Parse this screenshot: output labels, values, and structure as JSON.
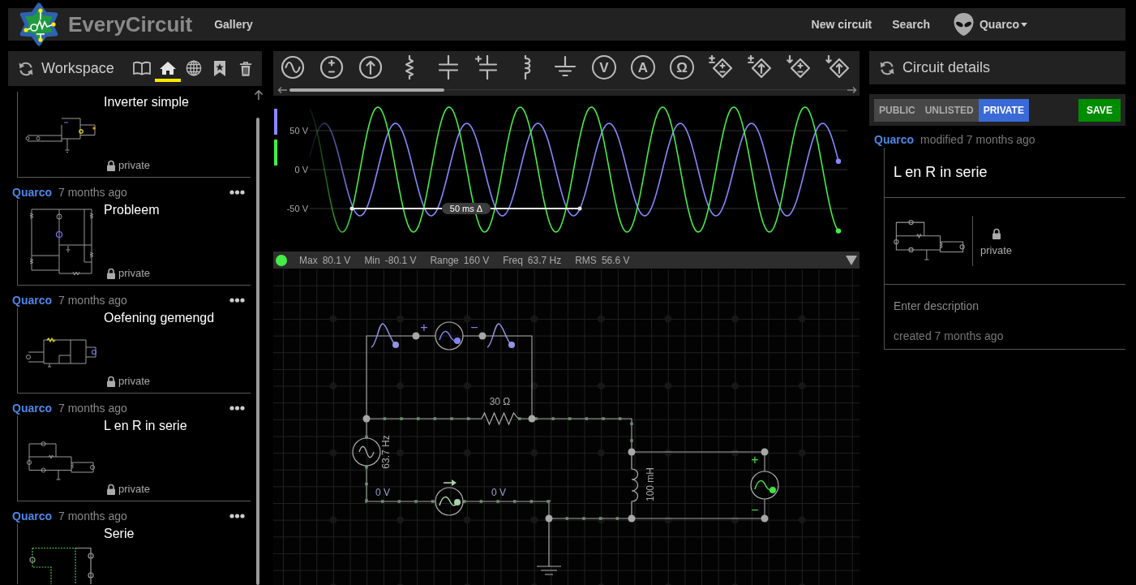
{
  "topbar": {
    "brand": "EveryCircuit",
    "nav": [
      "Gallery"
    ],
    "actions": [
      "New circuit",
      "Search"
    ],
    "user": "Quarco"
  },
  "workspace": {
    "title": "Workspace",
    "tabs": [
      {
        "kind": "book",
        "selected": false
      },
      {
        "kind": "home",
        "selected": true
      },
      {
        "kind": "globe",
        "selected": false
      },
      {
        "kind": "bookmark",
        "selected": false
      },
      {
        "kind": "trash",
        "selected": false
      }
    ],
    "circuits": [
      {
        "title": "Inverter simple",
        "visibility": "private"
      },
      {
        "author": "Quarco",
        "time": "7 months ago",
        "title": "Probleem",
        "visibility": "private"
      },
      {
        "author": "Quarco",
        "time": "7 months ago",
        "title": "Oefening gemengd",
        "visibility": "private"
      },
      {
        "author": "Quarco",
        "time": "7 months ago",
        "title": "L en R in serie",
        "visibility": "private"
      },
      {
        "author": "Quarco",
        "time": "7 months ago",
        "title": "Serie"
      }
    ]
  },
  "toolbar": {
    "items": [
      {
        "kind": "ac_voltage_source"
      },
      {
        "kind": "dc_voltage_source"
      },
      {
        "kind": "current_source"
      },
      {
        "kind": "resistor"
      },
      {
        "kind": "capacitor"
      },
      {
        "kind": "polarized_capacitor"
      },
      {
        "kind": "inductor"
      },
      {
        "kind": "ground"
      },
      {
        "kind": "voltmeter",
        "glyph": "V"
      },
      {
        "kind": "ammeter",
        "glyph": "A"
      },
      {
        "kind": "ohmmeter",
        "glyph": "Ω"
      },
      {
        "kind": "vcvs"
      },
      {
        "kind": "vccs"
      },
      {
        "kind": "ccvs"
      },
      {
        "kind": "cccs"
      }
    ]
  },
  "scope": {
    "traces": [
      {
        "color": "#8888ff"
      },
      {
        "color": "#44ee44"
      }
    ],
    "y_labels": [
      "50 V",
      "0 V",
      "-50 V"
    ],
    "marker": "50 ms Δ",
    "stats": [
      {
        "label": "Max",
        "value": "80.1 V"
      },
      {
        "label": "Min",
        "value": "-80.1 V"
      },
      {
        "label": "Range",
        "value": "160 V"
      },
      {
        "label": "Freq",
        "value": "63.7 Hz"
      },
      {
        "label": "RMS",
        "value": "56.6 V"
      }
    ]
  },
  "circuit": {
    "components": [
      {
        "kind": "probe_marker",
        "color": "#9494e4"
      },
      {
        "kind": "source",
        "color": "#8484f4",
        "plus": "+",
        "minus": "−"
      },
      {
        "kind": "probe_marker",
        "color": "#9494e4"
      },
      {
        "kind": "resistor",
        "label": "30 Ω"
      },
      {
        "kind": "generator",
        "label": "63.7 Hz"
      },
      {
        "kind": "ammeter",
        "color": "#a6d4a6"
      },
      {
        "kind": "inductor",
        "label": "100 mH"
      },
      {
        "kind": "source",
        "color": "#44e044",
        "plus": "+",
        "minus": "−"
      },
      {
        "kind": "ground"
      }
    ],
    "node_labels": [
      "0 V",
      "0 V"
    ]
  },
  "details": {
    "title": "Circuit details",
    "visibility_options": [
      {
        "label": "PUBLIC",
        "selected": false
      },
      {
        "label": "UNLISTED",
        "selected": false
      },
      {
        "label": "PRIVATE",
        "selected": true
      }
    ],
    "save": "SAVE",
    "author": "Quarco",
    "modified": "modified 7 months ago",
    "name": "L en R in serie",
    "visibility": "private",
    "description": {
      "placeholder": "Enter description"
    },
    "created": "created 7 months ago"
  }
}
